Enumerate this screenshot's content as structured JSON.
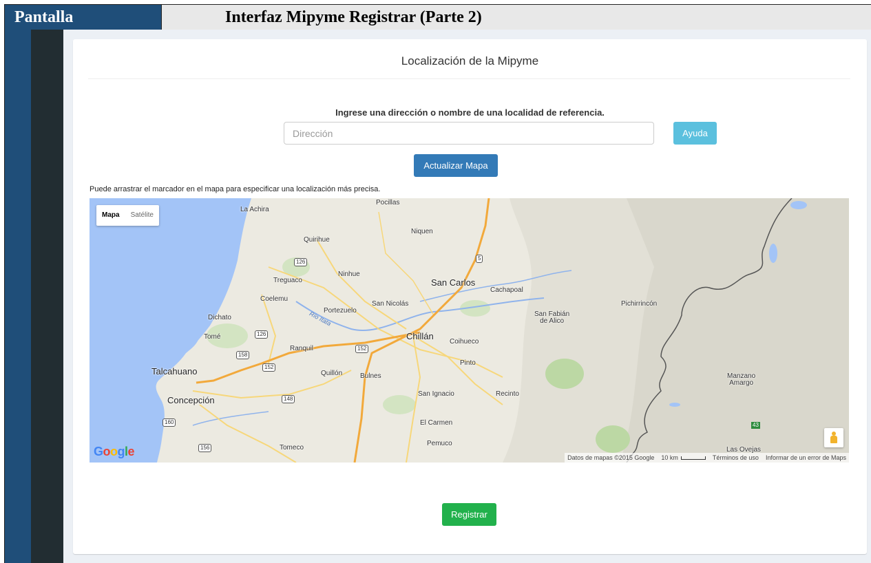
{
  "header": {
    "left_label": "Pantalla",
    "title": "Interfaz Mipyme  Registrar (Parte 2)"
  },
  "panel": {
    "title": "Localización de la Mipyme",
    "instruction": "Ingrese una dirección o nombre de una localidad de referencia.",
    "address_placeholder": "Dirección",
    "address_value": "",
    "help_button": "Ayuda",
    "update_map_button": "Actualizar Mapa",
    "drag_hint": "Puede arrastrar el marcador en el mapa para especificar una localización más precisa.",
    "register_button": "Registrar"
  },
  "map": {
    "type_control": {
      "active": "Mapa",
      "inactive": "Satélite"
    },
    "places": [
      {
        "id": "la-achira",
        "name": "La Achira"
      },
      {
        "id": "pocillas",
        "name": "Pocillas"
      },
      {
        "id": "niquen",
        "name": "Niquen"
      },
      {
        "id": "quirihue",
        "name": "Quirihue"
      },
      {
        "id": "ninhue",
        "name": "Ninhue"
      },
      {
        "id": "san-carlos",
        "name": "San Carlos"
      },
      {
        "id": "treguaco",
        "name": "Treguaco"
      },
      {
        "id": "cachapoal",
        "name": "Cachapoal"
      },
      {
        "id": "coelemu",
        "name": "Coelemu"
      },
      {
        "id": "san-nicolas",
        "name": "San Nicolás"
      },
      {
        "id": "portezuelo",
        "name": "Portezuelo"
      },
      {
        "id": "san-fabian",
        "name": "San Fabián\nde Alico"
      },
      {
        "id": "pichirrincon",
        "name": "Pichirrincón"
      },
      {
        "id": "dichato",
        "name": "Dichato"
      },
      {
        "id": "tome",
        "name": "Tomé"
      },
      {
        "id": "chillan",
        "name": "Chillán"
      },
      {
        "id": "coihueco",
        "name": "Coihueco"
      },
      {
        "id": "ranquil",
        "name": "Ranquil"
      },
      {
        "id": "pinto",
        "name": "Pinto"
      },
      {
        "id": "talcahuano",
        "name": "Talcahuano"
      },
      {
        "id": "quillon",
        "name": "Quillón"
      },
      {
        "id": "bulnes",
        "name": "Bulnes"
      },
      {
        "id": "manzano",
        "name": "Manzano\nAmargo"
      },
      {
        "id": "concepcion",
        "name": "Concepción"
      },
      {
        "id": "san-ignacio",
        "name": "San Ignacio"
      },
      {
        "id": "recinto",
        "name": "Recinto"
      },
      {
        "id": "el-carmen",
        "name": "El Carmen"
      },
      {
        "id": "pemuco",
        "name": "Pemuco"
      },
      {
        "id": "tomeco",
        "name": "Tomeco"
      },
      {
        "id": "las-ovejas",
        "name": "Las Ovejas"
      }
    ],
    "river_label": "Río Itata",
    "route_shields": [
      "126",
      "5",
      "126",
      "158",
      "152",
      "152",
      "148",
      "160",
      "156"
    ],
    "green_shield": "43",
    "logo": "Google",
    "footer": {
      "data_credit": "Datos de mapas ©2015 Google",
      "scale": "10 km",
      "terms": "Términos de uso",
      "report": "Informar de un error de Maps"
    },
    "colors": {
      "water": "#a3c4f7",
      "land": "#eceae1",
      "mountain": "#d6d4c8",
      "highway": "#f2a93b",
      "road": "#f7d77a",
      "border": "#555555"
    }
  }
}
